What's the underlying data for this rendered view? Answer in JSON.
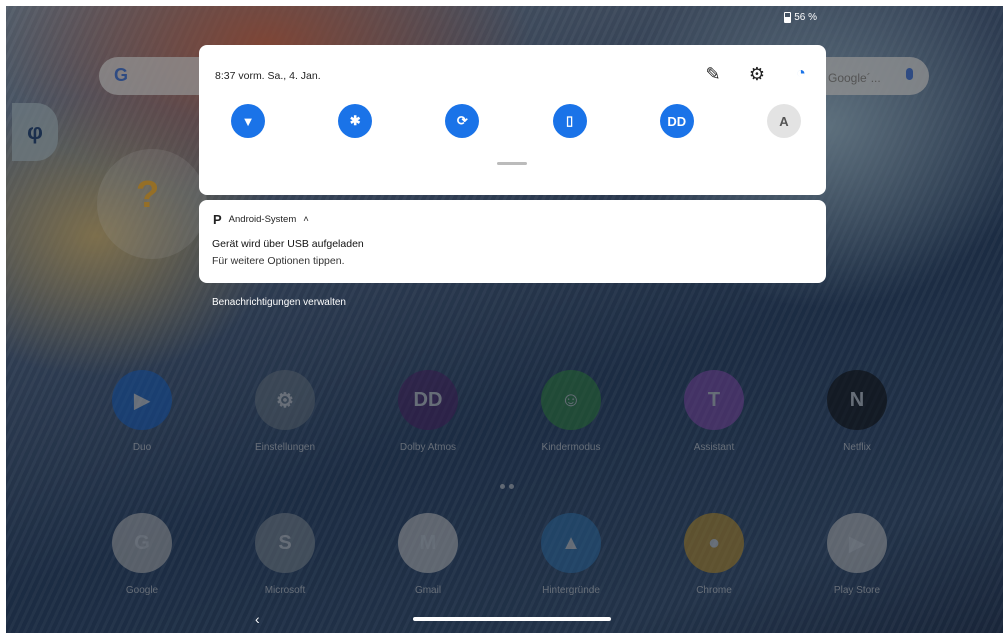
{
  "status_bar": {
    "battery": "56 %"
  },
  "google_bar": {
    "g": "G",
    "placeholder": "Google´..."
  },
  "quick_settings": {
    "time_date": "8:37 vorm.  Sa., 4. Jan.",
    "top_icons": [
      "edit-icon",
      "settings-icon",
      "account-icon"
    ],
    "tiles": [
      {
        "name": "wifi-off-tile",
        "glyph": "▼",
        "active": true
      },
      {
        "name": "bluetooth-tile",
        "glyph": "✱",
        "active": true
      },
      {
        "name": "auto-rotate-tile",
        "glyph": "⟳",
        "active": true
      },
      {
        "name": "vibrate-tile",
        "glyph": "▯",
        "active": true
      },
      {
        "name": "dolby-tile",
        "glyph": "DD",
        "active": true
      },
      {
        "name": "auto-brightness-tile",
        "glyph": "A",
        "active": false
      }
    ]
  },
  "notification": {
    "app": "Android-System",
    "title": "Gerät wird über USB aufgeladen",
    "body": "Für weitere Optionen tippen."
  },
  "manage_notifications": "Benachrichtigungen verwalten",
  "apps_row1": [
    {
      "label": "Duo",
      "color": "#1a73e8",
      "glyph": "▶"
    },
    {
      "label": "Einstellungen",
      "color": "#7a8a99",
      "glyph": "⚙"
    },
    {
      "label": "Dolby Atmos",
      "color": "#5a2a7a",
      "glyph": "DD"
    },
    {
      "label": "Kindermodus",
      "color": "#3aa04a",
      "glyph": "☺"
    },
    {
      "label": "Assistant",
      "color": "#a05ad0",
      "glyph": "T"
    },
    {
      "label": "Netflix",
      "color": "#111111",
      "glyph": "N"
    }
  ],
  "apps_row2": [
    {
      "label": "Google",
      "color": "#dddddd",
      "glyph": "G"
    },
    {
      "label": "Microsoft",
      "color": "#9aa5b0",
      "glyph": "S"
    },
    {
      "label": "Gmail",
      "color": "#eeeeee",
      "glyph": "M"
    },
    {
      "label": "Hintergründe",
      "color": "#3a8ad0",
      "glyph": "▲"
    },
    {
      "label": "Chrome",
      "color": "#e8b030",
      "glyph": "●"
    },
    {
      "label": "Play Store",
      "color": "#e8e8e8",
      "glyph": "▶"
    }
  ],
  "nav": {
    "back": "‹"
  }
}
